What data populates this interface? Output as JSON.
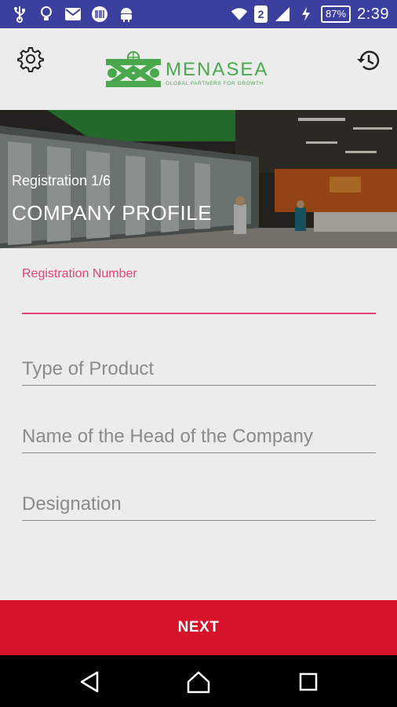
{
  "status_bar": {
    "notification_count": "2",
    "battery_percent": "87%",
    "time": "2:39",
    "icons": [
      "usb-icon",
      "lightbulb-icon",
      "mail-icon",
      "barcode-icon",
      "android-icon",
      "wifi-icon",
      "signal-icon",
      "charging-icon"
    ]
  },
  "header": {
    "logo_name": "MENASEA",
    "logo_tagline": "GLOBAL PARTNERS FOR GROWTH",
    "settings_icon": "gear-icon",
    "history_icon": "history-icon"
  },
  "hero": {
    "step_label": "Registration 1/6",
    "title": "COMPANY PROFILE"
  },
  "form": {
    "registration_number": {
      "label": "Registration Number",
      "value": ""
    },
    "type_of_product": {
      "placeholder": "Type of Product",
      "value": ""
    },
    "head_name": {
      "placeholder": "Name of the Head of the Company",
      "value": ""
    },
    "designation": {
      "placeholder": "Designation",
      "value": ""
    }
  },
  "actions": {
    "next_label": "NEXT"
  },
  "colors": {
    "status_bar": "#3b3f9e",
    "accent": "#e5407a",
    "primary_button": "#d6132a",
    "logo_green": "#4aa84c"
  }
}
